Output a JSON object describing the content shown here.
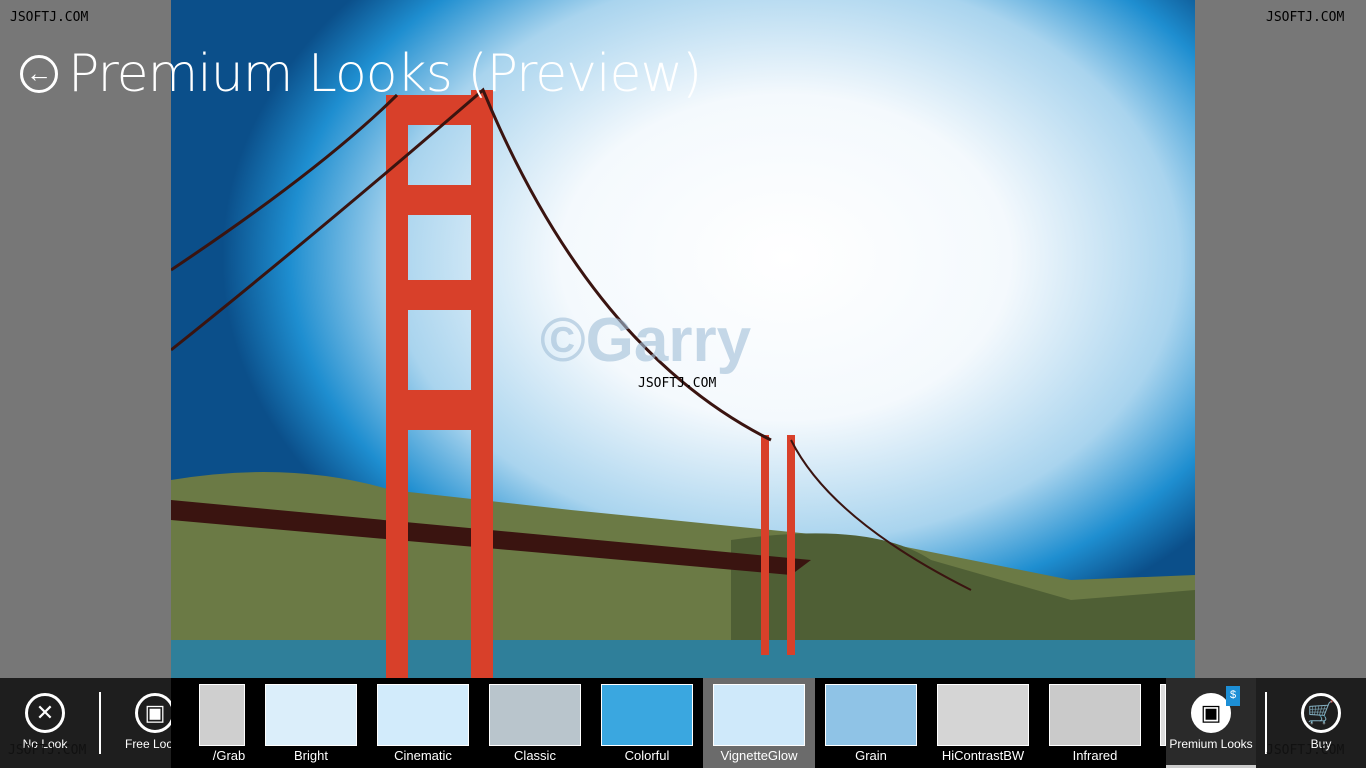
{
  "watermarks": [
    "JSOFTJ.COM",
    "JSOFTJ.COM",
    "JSOFTJ.COM",
    "JSOFTJ.COM",
    "JSOFTJ.COM"
  ],
  "header": {
    "title": "Premium Looks (Preview)",
    "back_icon": "arrow-left-icon"
  },
  "photo": {
    "watermark": "©Garry"
  },
  "appbar": {
    "no_look": "No Look",
    "free_looks": "Free Looks",
    "premium_looks": "Premium Looks",
    "buy": "Buy",
    "looks": [
      {
        "label": "/Grab",
        "bg": "#cfcfcf"
      },
      {
        "label": "Bright",
        "bg": "#dbeefa"
      },
      {
        "label": "Cinematic",
        "bg": "#d2ebfb"
      },
      {
        "label": "Classic",
        "bg": "#b9c5cc"
      },
      {
        "label": "Colorful",
        "bg": "#3aa7e0"
      },
      {
        "label": "VignetteGlow",
        "bg": "#cfe9fa",
        "selected": true
      },
      {
        "label": "Grain",
        "bg": "#8fc3e6"
      },
      {
        "label": "HiContrastBW",
        "bg": "#d5d5d5"
      },
      {
        "label": "Infrared",
        "bg": "#cacaca"
      }
    ]
  },
  "colors": {
    "appbar": "#1e1e1e",
    "selected": "#6b6b6b",
    "price_tag": "#1d8fd6"
  }
}
